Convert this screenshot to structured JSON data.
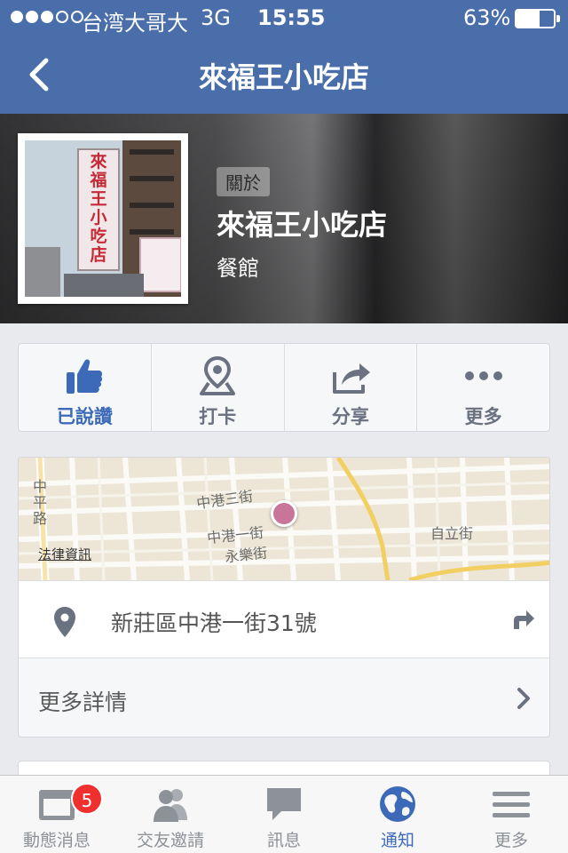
{
  "status_bar": {
    "carrier": "台湾大哥大",
    "network": "3G",
    "time": "15:55",
    "battery": "63%",
    "battery_level": 0.63,
    "signal_bars": 3,
    "signal_total": 5
  },
  "nav": {
    "title": "來福王小吃店",
    "back_icon": "chevron-left-icon"
  },
  "profile": {
    "badge": "關於",
    "name": "來福王小吃店",
    "category": "餐館",
    "photo_sign_text": "來福王小吃店"
  },
  "actions": [
    {
      "label": "已說讚",
      "icon": "thumbs-up-icon",
      "active": true
    },
    {
      "label": "打卡",
      "icon": "checkin-pin-icon",
      "active": false
    },
    {
      "label": "分享",
      "icon": "share-icon",
      "active": false
    },
    {
      "label": "更多",
      "icon": "more-dots-icon",
      "active": false
    }
  ],
  "map": {
    "streets": [
      "中港三街",
      "中港一街",
      "永樂街",
      "自立街",
      "中平路"
    ],
    "legal": "法律資訊"
  },
  "location": {
    "address": "新莊區中港一街31號",
    "more_details": "更多詳情"
  },
  "tabs": [
    {
      "label": "動態消息",
      "icon": "news-feed-icon",
      "badge": "5",
      "active": false
    },
    {
      "label": "交友邀請",
      "icon": "friend-requests-icon",
      "active": false
    },
    {
      "label": "訊息",
      "icon": "messages-icon",
      "active": false
    },
    {
      "label": "通知",
      "icon": "globe-icon",
      "active": true
    },
    {
      "label": "更多",
      "icon": "menu-icon",
      "active": false
    }
  ],
  "colors": {
    "header_blue": "#4a6ea9",
    "active_blue": "#3d6ab8",
    "inactive_gray": "#8d9298",
    "badge_red": "#f02f2f",
    "map_pin": "#c9759a"
  }
}
